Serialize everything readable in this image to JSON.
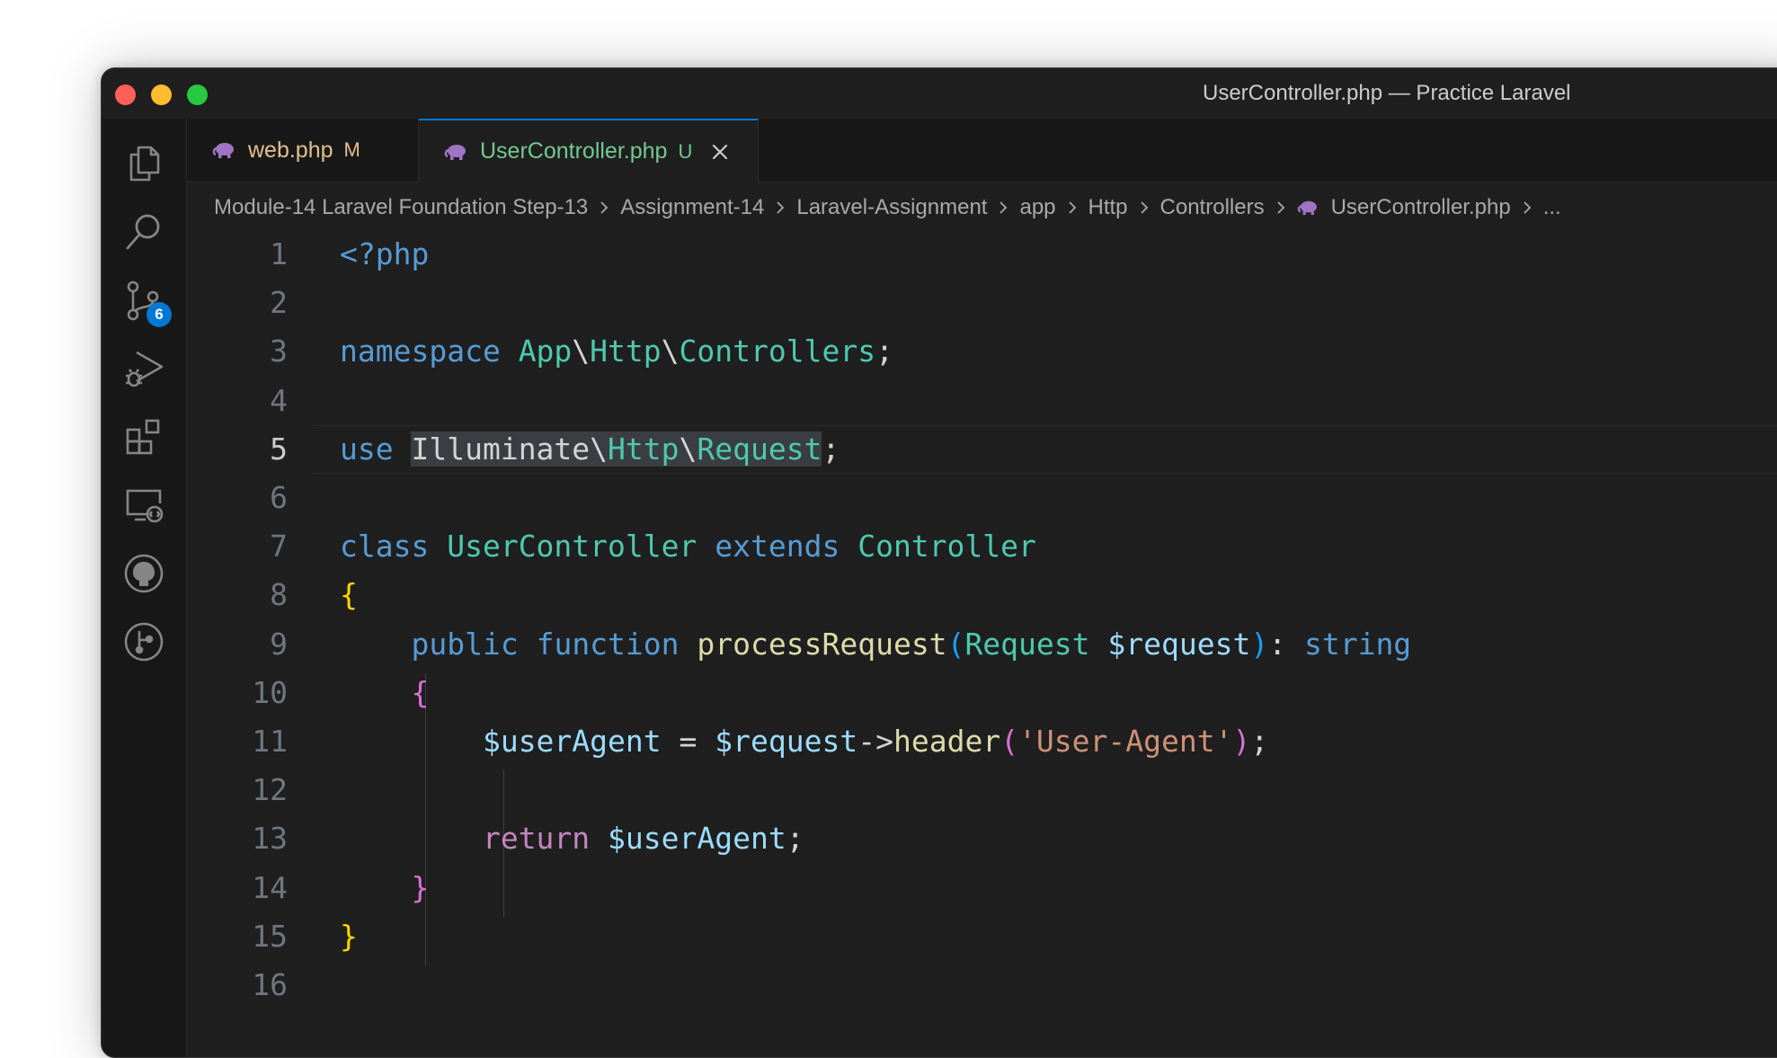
{
  "window": {
    "title": "UserController.php — Practice Laravel"
  },
  "activity_bar": {
    "items": [
      {
        "icon": "files-icon"
      },
      {
        "icon": "search-icon"
      },
      {
        "icon": "source-control-icon",
        "badge": "6"
      },
      {
        "icon": "run-debug-icon"
      },
      {
        "icon": "extensions-icon"
      },
      {
        "icon": "remote-explorer-icon"
      },
      {
        "icon": "github-icon"
      },
      {
        "icon": "git-graph-icon"
      }
    ]
  },
  "tabs": [
    {
      "label": "web.php",
      "status": "M",
      "active": false
    },
    {
      "label": "UserController.php",
      "status": "U",
      "active": true
    }
  ],
  "breadcrumb": {
    "items": [
      "Module-14 Laravel Foundation Step-13",
      "Assignment-14",
      "Laravel-Assignment",
      "app",
      "Http",
      "Controllers",
      "UserController.php",
      "..."
    ]
  },
  "editor": {
    "current_line": 5,
    "line_numbers": [
      "1",
      "2",
      "3",
      "4",
      "5",
      "6",
      "7",
      "8",
      "9",
      "10",
      "11",
      "12",
      "13",
      "14",
      "15",
      "16"
    ],
    "lines": [
      "<?php",
      "",
      "namespace App\\Http\\Controllers;",
      "",
      "use Illuminate\\Http\\Request;",
      "",
      "class UserController extends Controller",
      "{",
      "    public function processRequest(Request $request): string",
      "    {",
      "        $userAgent = $request->header('User-Agent');",
      "",
      "        return $userAgent;",
      "    }",
      "}",
      ""
    ]
  },
  "colors": {
    "keyword": "#569cd6",
    "control": "#c586c0",
    "type": "#4ec9b0",
    "function": "#dcdcaa",
    "variable": "#9cdcfe",
    "string": "#ce9178",
    "modified": "#e2c08d",
    "untracked": "#73c991",
    "accent": "#0078d4"
  }
}
